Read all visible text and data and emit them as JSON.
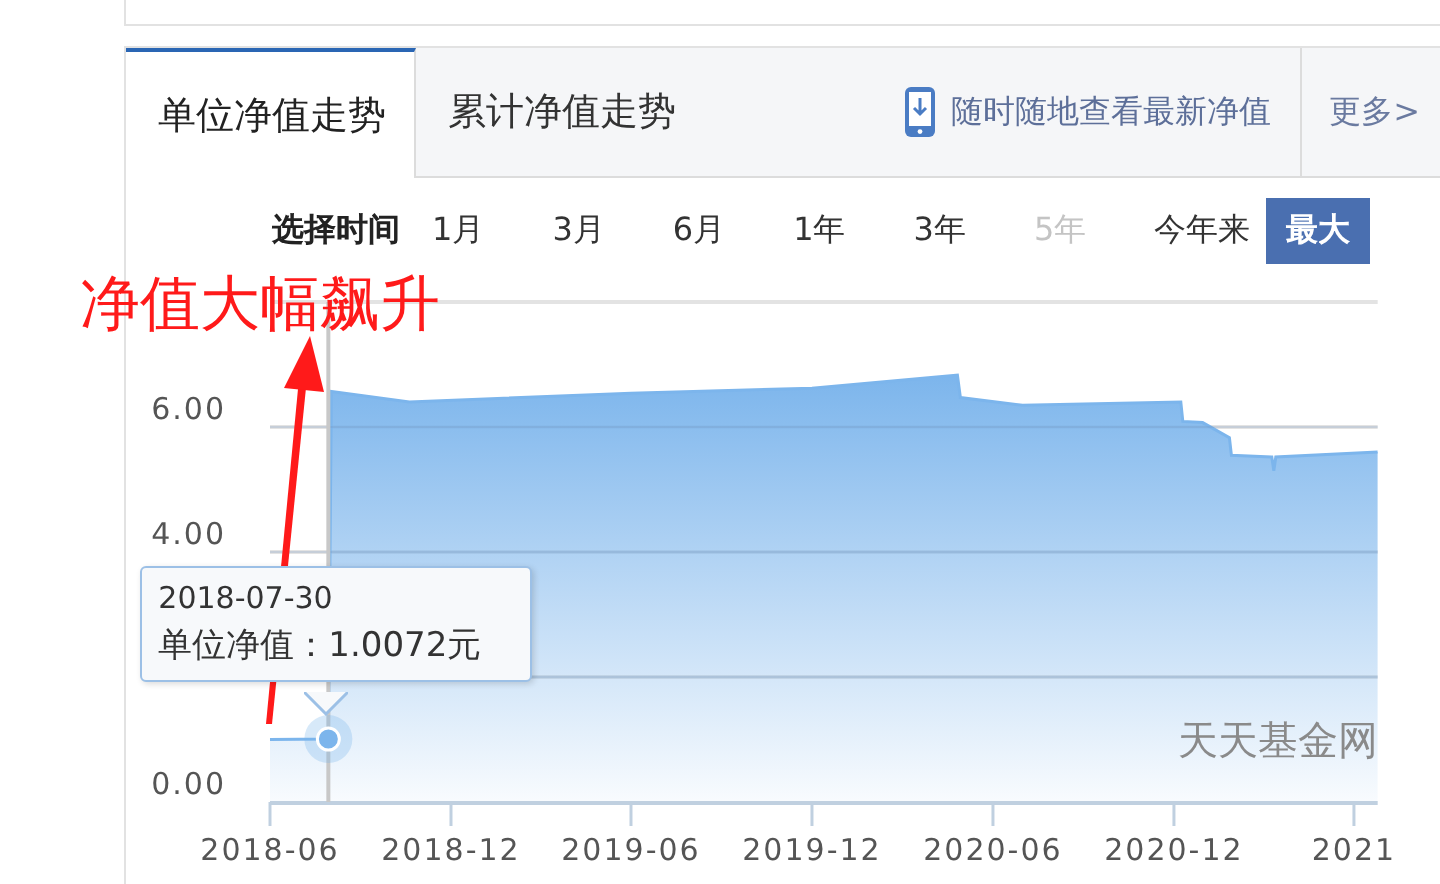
{
  "tabs": [
    {
      "label": "单位净值走势",
      "selected": true
    },
    {
      "label": "累计净值走势",
      "selected": false
    }
  ],
  "promo_link": {
    "label": "随时随地查看最新净值"
  },
  "more_link": {
    "label": "更多>"
  },
  "period_selector": {
    "label": "选择时间",
    "options": [
      {
        "label": "1月",
        "selected": false,
        "disabled": false
      },
      {
        "label": "3月",
        "selected": false,
        "disabled": false
      },
      {
        "label": "6月",
        "selected": false,
        "disabled": false
      },
      {
        "label": "1年",
        "selected": false,
        "disabled": false
      },
      {
        "label": "3年",
        "selected": false,
        "disabled": false
      },
      {
        "label": "5年",
        "selected": false,
        "disabled": true
      },
      {
        "label": "今年来",
        "selected": false,
        "disabled": false
      },
      {
        "label": "最大",
        "selected": true,
        "disabled": false
      }
    ]
  },
  "annotation": {
    "text": "净值大幅飙升"
  },
  "chart": {
    "credit": "天天基金网",
    "tooltip": {
      "date": "2018-07-30",
      "value_text": "单位净值：1.0072元"
    },
    "chart_data": {
      "type": "area",
      "x": [
        "2018-06-01",
        "2018-07-30",
        "2018-08-02",
        "2018-10-20",
        "2019-06-01",
        "2019-12-01",
        "2020-04-26",
        "2020-04-29",
        "2020-07-01",
        "2020-12-08",
        "2020-12-10",
        "2020-12-30",
        "2021-01-26",
        "2021-01-28",
        "2021-03-10",
        "2021-03-12",
        "2021-03-14",
        "2021-06-25"
      ],
      "xlim": [
        "2018-06-01",
        "2021-06-25"
      ],
      "grid": true,
      "series": [
        {
          "color": "#7cb5ec",
          "values": [
            1.0,
            1.0072,
            6.57,
            6.4,
            6.54,
            6.62,
            6.83,
            6.47,
            6.35,
            6.4,
            6.09,
            6.07,
            5.83,
            5.55,
            5.52,
            5.3,
            5.52,
            5.6
          ]
        }
      ],
      "ref_lines": [
        {
          "axis": "x",
          "value": "2018-07-30"
        }
      ],
      "yticks": [
        {
          "value": 0,
          "label": "0.00"
        },
        {
          "value": 4,
          "label": "4.00"
        },
        {
          "value": 6,
          "label": "6.00"
        }
      ],
      "ylim": [
        0,
        8
      ],
      "xticks": [
        {
          "value": "2018-06-01",
          "label": "2018-06"
        },
        {
          "value": "2018-12-01",
          "label": "2018-12"
        },
        {
          "value": "2019-06-01",
          "label": "2019-06"
        },
        {
          "value": "2019-12-01",
          "label": "2019-12"
        },
        {
          "value": "2020-06-01",
          "label": "2020-06"
        },
        {
          "value": "2020-12-01",
          "label": "2020-12"
        },
        {
          "value": "2021-06-01",
          "label": "2021"
        }
      ]
    }
  }
}
